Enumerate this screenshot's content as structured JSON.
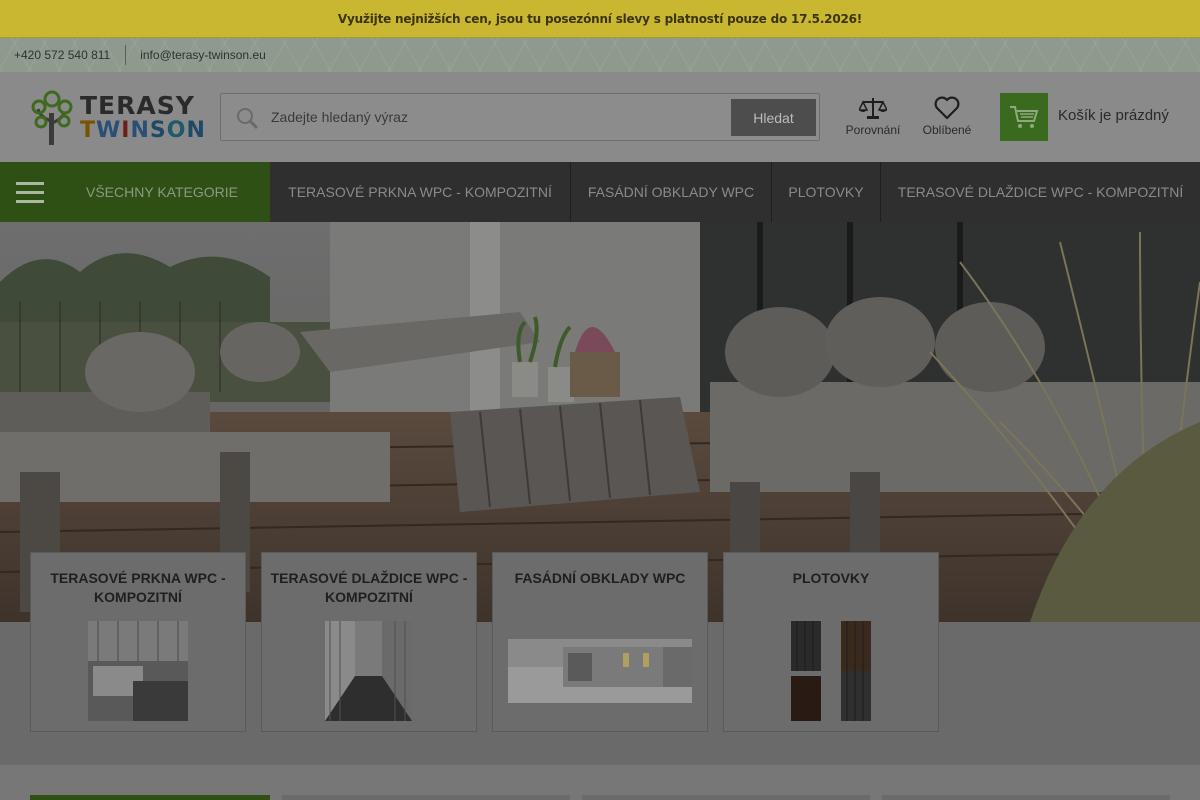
{
  "promo": {
    "text": "Využijte nejnižších cen, jsou tu posezónní slevy s platností pouze do 17.5.2026!"
  },
  "contact": {
    "phone": "+420 572 540 811",
    "email": "info@terasy-twinson.eu"
  },
  "logo": {
    "line1": "TERASY",
    "line2": [
      "T",
      "W",
      "I",
      "N",
      "S",
      "O",
      "N"
    ]
  },
  "search": {
    "placeholder": "Zadejte hledaný výraz",
    "button": "Hledat"
  },
  "header_icons": {
    "compare": "Porovnání",
    "favorites": "Oblíbené"
  },
  "cart": {
    "label": "Košík je prázdný"
  },
  "nav": {
    "all_categories": "VŠECHNY KATEGORIE",
    "items": [
      "TERASOVÉ PRKNA WPC - KOMPOZITNÍ",
      "FASÁDNÍ OBKLADY WPC",
      "PLOTOVKY",
      "TERASOVÉ DLAŽDICE WPC - KOMPOZITNÍ"
    ]
  },
  "categories": [
    {
      "title": "TERASOVÉ PRKNA WPC - KOMPOZITNÍ"
    },
    {
      "title": "TERASOVÉ DLAŽDICE WPC - KOMPOZITNÍ"
    },
    {
      "title": "FASÁDNÍ OBKLADY WPC"
    },
    {
      "title": "PLOTOVKY"
    }
  ],
  "colors": {
    "accent_green": "#2e5015",
    "promo_bg": "#c9b631",
    "nav_bg": "#2f2f2f"
  }
}
